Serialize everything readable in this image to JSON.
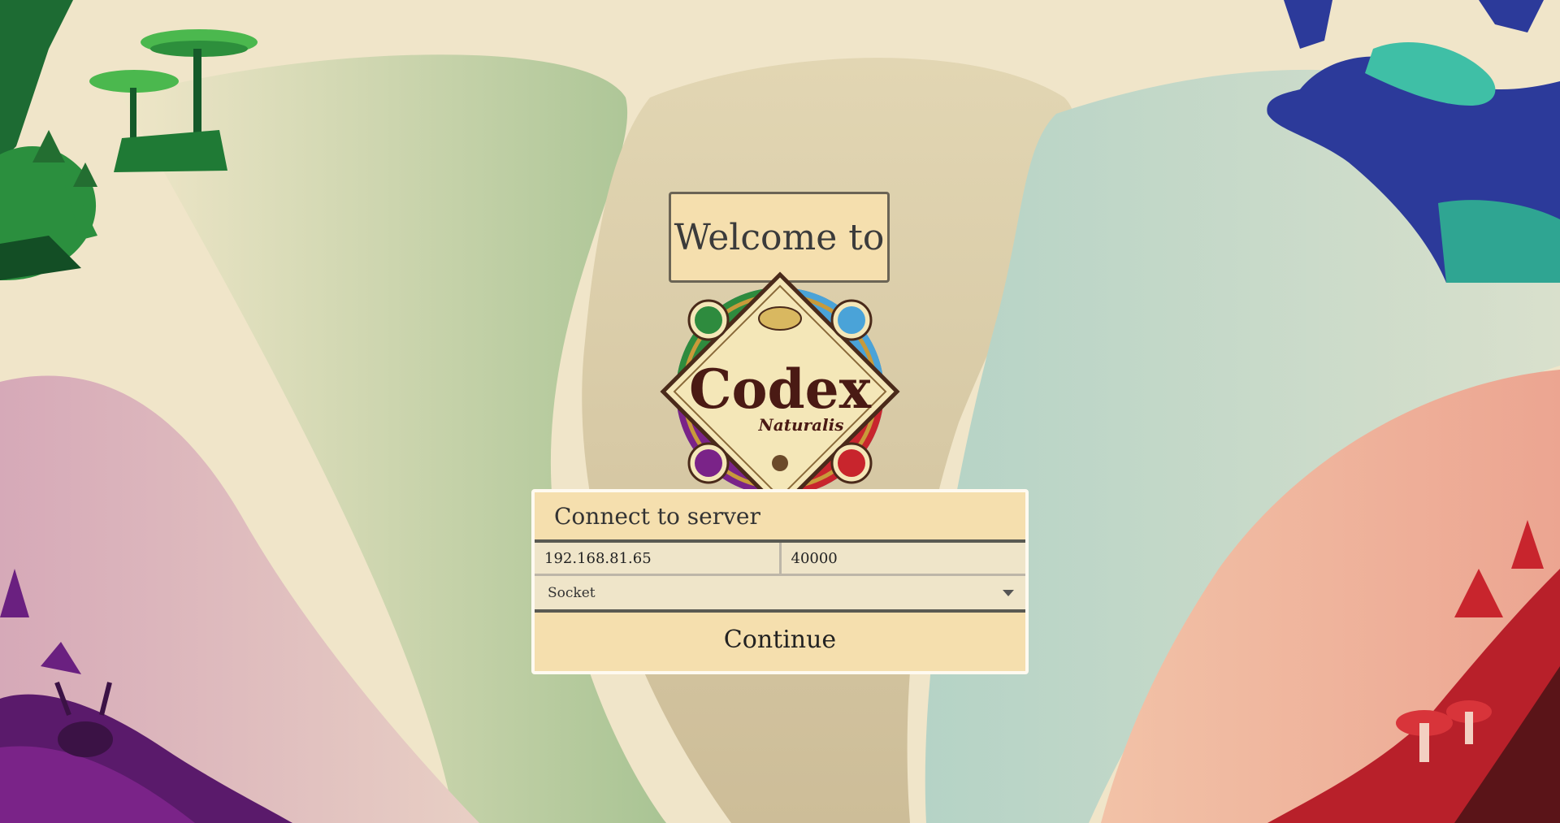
{
  "welcome": {
    "text": "Welcome to"
  },
  "logo": {
    "title": "Codex",
    "subtitle": "Naturalis"
  },
  "connect_panel": {
    "title": "Connect to server",
    "ip_value": "192.168.81.65",
    "port_value": "40000",
    "connection_type": "Socket",
    "continue_label": "Continue"
  },
  "colors": {
    "background": "#f0e5c9",
    "panel": "#f5dfae",
    "field": "#efe5c9",
    "plant": "#2e8b3e",
    "animal": "#2c3a9a",
    "insect": "#7a2388",
    "fungi": "#c8252d"
  }
}
